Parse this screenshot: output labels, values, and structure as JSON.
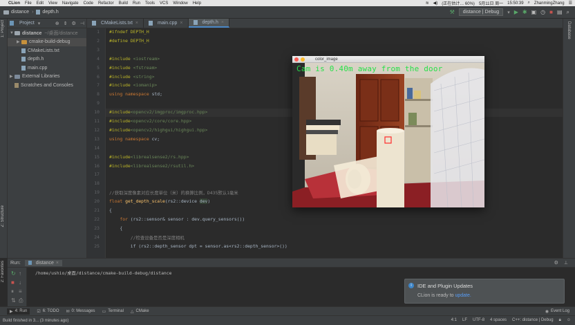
{
  "menubar": {
    "apple": "",
    "items": [
      "CLion",
      "File",
      "Edit",
      "View",
      "Navigate",
      "Code",
      "Refactor",
      "Build",
      "Run",
      "Tools",
      "VCS",
      "Window",
      "Help"
    ],
    "status": "(正在估计… 60%)",
    "date": "5月11日 周一",
    "time": "15:50:39",
    "user": "ZhanmingZhang"
  },
  "titlebar": {
    "breadcrumb": [
      "distance",
      "depth.h"
    ],
    "run_config": "distance | Debug"
  },
  "tabs": [
    {
      "label": "CMakeLists.txt",
      "active": false
    },
    {
      "label": "main.cpp",
      "active": false
    },
    {
      "label": "depth.h",
      "active": true
    }
  ],
  "left_strip": {
    "project": "1: Project",
    "structure": "Z: Structure",
    "favorites": "2: Favorites"
  },
  "project_panel": {
    "header": "Project",
    "tree": [
      {
        "label": "distance",
        "extra": "~/桌面/distance",
        "depth": 0,
        "kind": "folder",
        "arrow": "▼"
      },
      {
        "label": "cmake-build-debug",
        "extra": "",
        "depth": 1,
        "kind": "folder-orange",
        "arrow": "▶"
      },
      {
        "label": "CMakeLists.txt",
        "extra": "",
        "depth": 1,
        "kind": "file",
        "arrow": ""
      },
      {
        "label": "depth.h",
        "extra": "",
        "depth": 1,
        "kind": "file",
        "arrow": ""
      },
      {
        "label": "main.cpp",
        "extra": "",
        "depth": 1,
        "kind": "file",
        "arrow": ""
      },
      {
        "label": "External Libraries",
        "extra": "",
        "depth": 0,
        "kind": "lib",
        "arrow": "▶"
      },
      {
        "label": "Scratches and Consoles",
        "extra": "",
        "depth": 0,
        "kind": "scratch",
        "arrow": ""
      }
    ]
  },
  "editor": {
    "lines": [
      {
        "n": "1",
        "segs": [
          [
            "pp",
            "#ifndef "
          ],
          [
            "pp",
            "DEPTH_H"
          ]
        ]
      },
      {
        "n": "2",
        "segs": [
          [
            "pp",
            "#define "
          ],
          [
            "pp",
            "DEPTH_H"
          ]
        ]
      },
      {
        "n": "3",
        "segs": []
      },
      {
        "n": "4",
        "segs": [
          [
            "pp",
            "#include "
          ],
          [
            "str",
            "<iostream>"
          ]
        ]
      },
      {
        "n": "5",
        "segs": [
          [
            "pp",
            "#include "
          ],
          [
            "str",
            "<fstream>"
          ]
        ]
      },
      {
        "n": "6",
        "segs": [
          [
            "pp",
            "#include "
          ],
          [
            "str",
            "<string>"
          ]
        ]
      },
      {
        "n": "7",
        "segs": [
          [
            "pp",
            "#include "
          ],
          [
            "str",
            "<iomanip>"
          ]
        ]
      },
      {
        "n": "8",
        "segs": [
          [
            "kw",
            "using namespace "
          ],
          [
            "cls",
            "std;"
          ]
        ]
      },
      {
        "n": "9",
        "segs": []
      },
      {
        "n": "10",
        "segs": [
          [
            "pp",
            "#include"
          ],
          [
            "str",
            "<opencv2/imgproc/imgproc.hpp>"
          ]
        ],
        "hl": true
      },
      {
        "n": "11",
        "segs": [
          [
            "pp",
            "#include"
          ],
          [
            "str",
            "<opencv2/core/core.hpp>"
          ]
        ]
      },
      {
        "n": "12",
        "segs": [
          [
            "pp",
            "#include"
          ],
          [
            "str",
            "<opencv2/highgui/highgui.hpp>"
          ]
        ]
      },
      {
        "n": "13",
        "segs": [
          [
            "kw",
            "using namespace "
          ],
          [
            "cls",
            "cv;"
          ]
        ]
      },
      {
        "n": "14",
        "segs": []
      },
      {
        "n": "15",
        "segs": [
          [
            "pp",
            "#include"
          ],
          [
            "str",
            "<librealsense2/rs.hpp>"
          ]
        ]
      },
      {
        "n": "16",
        "segs": [
          [
            "pp",
            "#include"
          ],
          [
            "str",
            "<librealsense2/rsutil.h>"
          ]
        ]
      },
      {
        "n": "17",
        "segs": []
      },
      {
        "n": "18",
        "segs": []
      },
      {
        "n": "19",
        "segs": [
          [
            "cm",
            "//获取深度像素对应长度单位（米）的换算比例，D435默认1毫米"
          ]
        ]
      },
      {
        "n": "20",
        "segs": [
          [
            "kw",
            "float "
          ],
          [
            "fn",
            "get_depth_scale"
          ],
          [
            "cls",
            "(rs2::device "
          ],
          [
            "hlw",
            "dev"
          ],
          [
            "cls",
            ")"
          ]
        ]
      },
      {
        "n": "21",
        "segs": [
          [
            "cls",
            "{"
          ]
        ]
      },
      {
        "n": "22",
        "segs": [
          [
            "kw",
            "    for "
          ],
          [
            "cls",
            "(rs2::sensor& sensor : dev.query_sensors())"
          ]
        ]
      },
      {
        "n": "23",
        "segs": [
          [
            "cls",
            "    {"
          ]
        ]
      },
      {
        "n": "24",
        "segs": [
          [
            "cm",
            "        //检查设备是否是深度相机"
          ]
        ]
      },
      {
        "n": "25",
        "segs": [
          [
            "cls",
            "        if (rs2::depth_sensor dpt = sensor.as<rs2::depth_sensor>())"
          ]
        ]
      }
    ]
  },
  "right_strip": {
    "database": "Database"
  },
  "image_window": {
    "title": "color_image",
    "overlay": "Cam is 0.40m away from the door"
  },
  "run_panel": {
    "label": "Run:",
    "tab": "distance",
    "output": "/home/ushio/桌面/distance/cmake-build-debug/distance"
  },
  "notification": {
    "title": "IDE and Plugin Updates",
    "text": "CLion is ready to ",
    "link": "update."
  },
  "bottom_tabs": [
    "4: Run",
    "6: TODO",
    "0: Messages",
    "Terminal",
    "CMake"
  ],
  "event_log": "Event Log",
  "status": {
    "message": "Build finished in 3... (3 minutes ago)",
    "position": "4:1",
    "line_sep": "LF",
    "encoding": "UTF-8",
    "indent": "4 spaces",
    "context": "C++: distance | Debug"
  },
  "colors": {
    "accent": "#4a88c7",
    "overlay_text": "#27e04a",
    "keyword": "#cc7832",
    "preproc": "#bbb529",
    "string": "#6a8759"
  }
}
